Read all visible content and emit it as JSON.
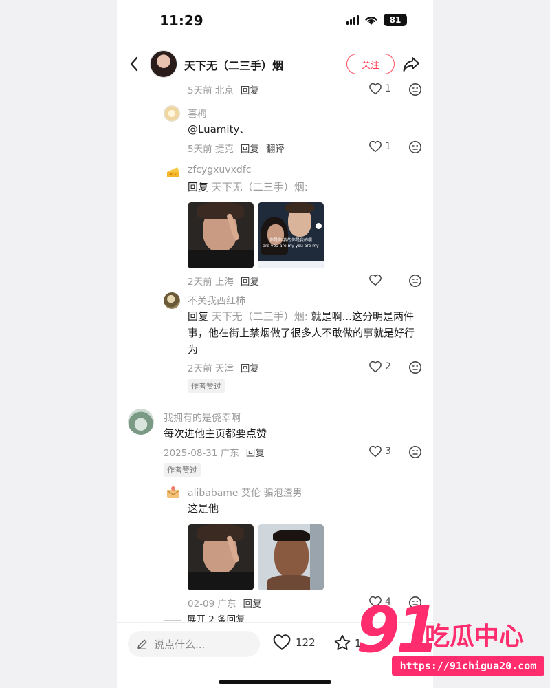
{
  "status_bar": {
    "time": "11:29",
    "battery": "81"
  },
  "header": {
    "title": "天下无（二三手）烟",
    "follow_label": "关注"
  },
  "comments": [
    {
      "meta": "5天前 北京",
      "reply_label": "回复",
      "likes": "1"
    },
    {
      "user": "喜梅",
      "text": "@Luamity、",
      "meta": "5天前 捷克",
      "reply_label": "回复",
      "translate_label": "翻译",
      "likes": "1"
    },
    {
      "user": "zfcygxuvxdfc",
      "reply_prefix": "回复",
      "reply_to": "天下无（二三手）烟:",
      "meta": "2天前 上海",
      "reply_label": "回复"
    },
    {
      "user": "不关我西红柿",
      "reply_prefix": "回复",
      "reply_to": "天下无（二三手）烟:",
      "text_line1": "就是啊...这分明是两件",
      "text_line2": "事，他在街上禁烟做了很多人不敢做的事就是好行",
      "text_line3": "为",
      "meta": "2天前 天津",
      "reply_label": "回复",
      "likes": "2",
      "badge": "作者赞过"
    },
    {
      "user": "我拥有的是侥幸啊",
      "text": "每次进他主页都要点赞",
      "meta": "2025-08-31 广东",
      "reply_label": "回复",
      "likes": "3",
      "badge": "作者赞过"
    },
    {
      "user": "alibabame 艾伦 骗泡渣男",
      "text": "这是他",
      "meta": "02-09 广东",
      "reply_label": "回复",
      "likes": "4",
      "expand_label": "展开 2 条回复"
    }
  ],
  "images": {
    "img2_caption": "你是你 我的你是我的樱",
    "img2_subtitle": "are you are my you are my"
  },
  "bottom_bar": {
    "input_placeholder": "说点什么...",
    "likes": "122",
    "stars": "1"
  },
  "watermark": {
    "logo": "91",
    "brand": "吃瓜中心",
    "url": "https://91chigua20.com"
  },
  "colors": {
    "accent": "#ff3b52",
    "watermark": "#ff2d6e"
  }
}
